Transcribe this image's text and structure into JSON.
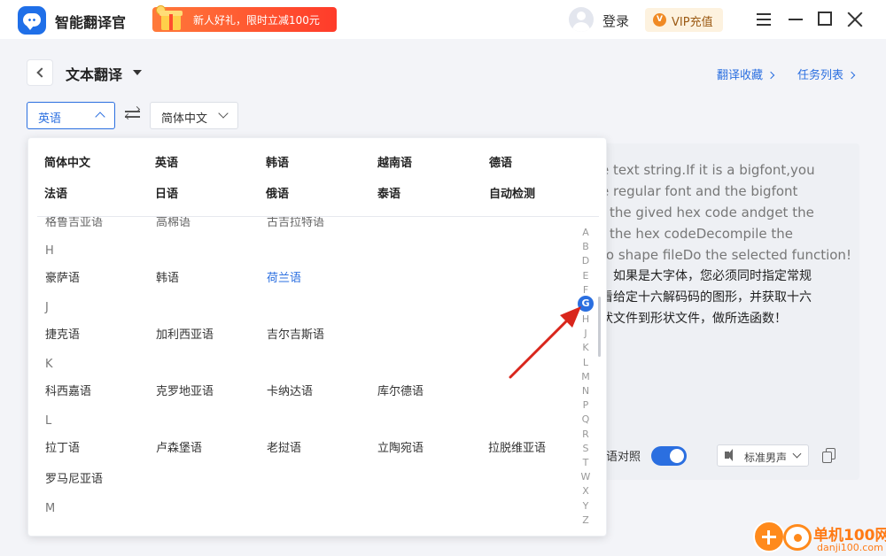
{
  "app": {
    "title": "智能翻译官",
    "promo": "新人好礼，限时立减100元",
    "login": "登录",
    "vip": "VIP充值",
    "vip_badge": "V"
  },
  "header": {
    "title": "文本翻译",
    "links": [
      "翻译收藏",
      "任务列表"
    ]
  },
  "source_lang": "英语",
  "target_lang": "简体中文",
  "dropdown": {
    "popular": [
      [
        "简体中文",
        "英语",
        "韩语",
        "越南语",
        "德语"
      ],
      [
        "法语",
        "日语",
        "俄语",
        "泰语",
        "自动检测"
      ]
    ],
    "cut_row": [
      "格鲁吉亚语",
      "高棉语",
      "古吉拉特语"
    ],
    "groups": [
      {
        "letter": "H",
        "items": [
          "豪萨语",
          "韩语",
          "荷兰语"
        ],
        "active": "荷兰语"
      },
      {
        "letter": "J",
        "items": [
          "捷克语",
          "加利西亚语",
          "吉尔吉斯语"
        ]
      },
      {
        "letter": "K",
        "items": [
          "科西嘉语",
          "克罗地亚语",
          "卡纳达语",
          "库尔德语"
        ]
      },
      {
        "letter": "L",
        "items": [
          "拉丁语",
          "卢森堡语",
          "老挝语",
          "立陶宛语",
          "拉脱维亚语",
          "罗马尼亚语"
        ]
      },
      {
        "letter": "M",
        "items": []
      }
    ],
    "alphabet": [
      "A",
      "B",
      "D",
      "E",
      "F",
      "G",
      "H",
      "J",
      "K",
      "L",
      "M",
      "N",
      "P",
      "Q",
      "R",
      "S",
      "T",
      "W",
      "X",
      "Y",
      "Z"
    ],
    "alphabet_active": "G"
  },
  "result": {
    "lines": [
      "e text string.If it is a bigfont,you",
      "e regular font and the bigfont",
      "f the gived hex code andget the",
      "f the hex codeDecompile the",
      "to shape fileDo the selected function!",
      "。如果是大字体，您必须同时指定常规",
      "看给定十六解码码的图形，并获取十六",
      "状文件到形状文件，做所选函数！"
    ],
    "compare_label": "语对照",
    "voice": "标准男声"
  },
  "watermark": {
    "name": "单机100网",
    "url": "danji100.com"
  },
  "colors": {
    "accent": "#2b6fe0",
    "promo": "#ff4a2a",
    "watermark": "#ff7a14",
    "annotation_arrow": "#d9261c"
  }
}
